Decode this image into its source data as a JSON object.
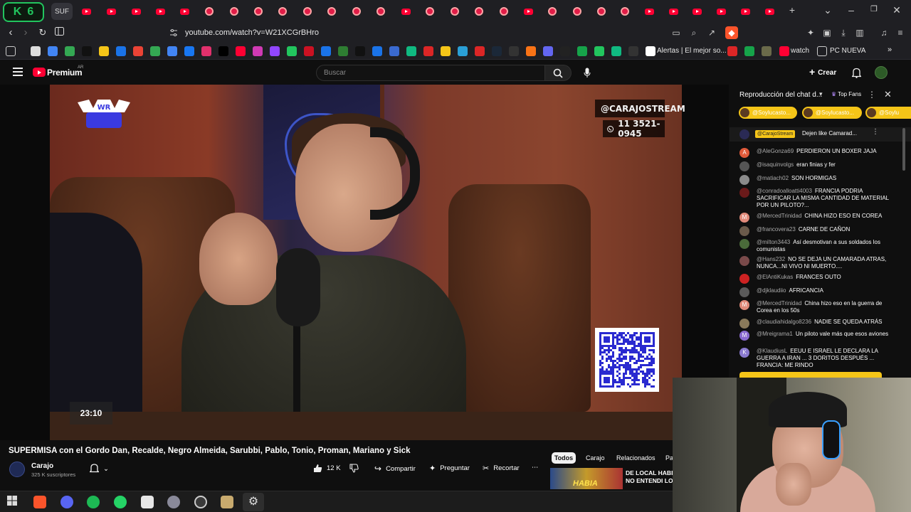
{
  "browser": {
    "k6_letter": "K",
    "k6_number": "6",
    "first_tab_label": "SUF",
    "url": "youtube.com/watch?v=W21XCGrBHro",
    "bookmarks": {
      "alertas": "Alertas | El mejor so...",
      "watch": "watch",
      "pc_nueva": "PC NUEVA"
    }
  },
  "youtube_header": {
    "brand": "Premium",
    "region": "AR",
    "search_placeholder": "Buscar",
    "create_label": "Crear"
  },
  "video_overlay": {
    "channel_handle": "@CARAJOSTREAM",
    "phone": "11 3521-0945",
    "timer": "23:10"
  },
  "chat": {
    "title": "Reproducción del chat d...",
    "top_fans_label": "Top Fans",
    "fan_pills": [
      "@Soylucasto...",
      "@Soylucasto...",
      "@Soylu"
    ],
    "pinned": {
      "author": "@CarajoStream",
      "message": "Dejen like Camarad..."
    },
    "messages": [
      {
        "author": "@AleGonza69",
        "text": "PERDIERON UN BOXER JAJA",
        "avatar_letter": "A",
        "avatar_color": "#e05a3a"
      },
      {
        "author": "@isaquinvolgs",
        "text": "eran finias y fer",
        "avatar_letter": "",
        "avatar_color": "#555555"
      },
      {
        "author": "@matiach02",
        "text": "SON HORMIGAS",
        "avatar_letter": "",
        "avatar_color": "#8a8a8a"
      },
      {
        "author": "@conradoalloatti4003",
        "text": "FRANCIA PODRIA SACRIFICAR LA MISMA CANTIDAD DE MATERIAL POR UN PILOTO?...",
        "avatar_letter": "",
        "avatar_color": "#6a1a1a"
      },
      {
        "author": "@MercedTrinidad",
        "text": "CHINA HIZO ESO EN COREA",
        "avatar_letter": "M",
        "avatar_color": "#e08a7a"
      },
      {
        "author": "@francovera23",
        "text": "CARNE DE CAÑON",
        "avatar_letter": "",
        "avatar_color": "#6a5a4a"
      },
      {
        "author": "@milton3443",
        "text": "Así desmotivan a sus soldados los comunistas",
        "avatar_letter": "",
        "avatar_color": "#4a6a3a"
      },
      {
        "author": "@Hans232",
        "text": "NO SE DEJA UN CAMARADA ATRAS, NUNCA...NI VIVO NI MUERTO....",
        "avatar_letter": "",
        "avatar_color": "#7a4a4a"
      },
      {
        "author": "@ElAntiKukas",
        "text": "FRANCES OUTO",
        "avatar_letter": "",
        "avatar_color": "#cc2222"
      },
      {
        "author": "@djklaudiio",
        "text": "AFRICANCIA",
        "avatar_letter": "",
        "avatar_color": "#5a5a5a"
      },
      {
        "author": "@MercedTrinidad",
        "text": "China hizo eso en la guerra de Corea en los 50s",
        "avatar_letter": "M",
        "avatar_color": "#e08a7a"
      },
      {
        "author": "@claudiahidalgo8236",
        "text": "NADIE SE QUEDA ATRÁS",
        "avatar_letter": "",
        "avatar_color": "#8a7a5a"
      },
      {
        "author": "@Mreigrama1",
        "text": "Un piloto vale más que esos aviones",
        "avatar_letter": "M",
        "avatar_color": "#8a6ad0"
      },
      {
        "author": "@KlaudiusL",
        "text": "EEUU E ISRAEL LE DECLARA LA GUERRA A IRAN ... 3 DORITOS DESPUÉS ... FRANCIA: ME RINDO",
        "avatar_letter": "K",
        "avatar_color": "#8a7ad0"
      }
    ]
  },
  "video_info": {
    "title": "SUPERMISA con el Gordo Dan, Recalde, Negro Almeida, Sarubbi, Pablo, Tonio, Proman, Mariano y Sick",
    "channel": "Carajo",
    "subscribers": "325 K suscriptores",
    "likes": "12 K",
    "share_label": "Compartir",
    "ask_label": "Preguntar",
    "clip_label": "Recortar"
  },
  "related_tabs": [
    "Todos",
    "Carajo",
    "Relacionados",
    "Pa"
  ],
  "related_video": {
    "title_line1": "DE LOCAL HABIA",
    "title_line2": "NO ENTENDI LOS",
    "thumb_text": "HABIA"
  }
}
